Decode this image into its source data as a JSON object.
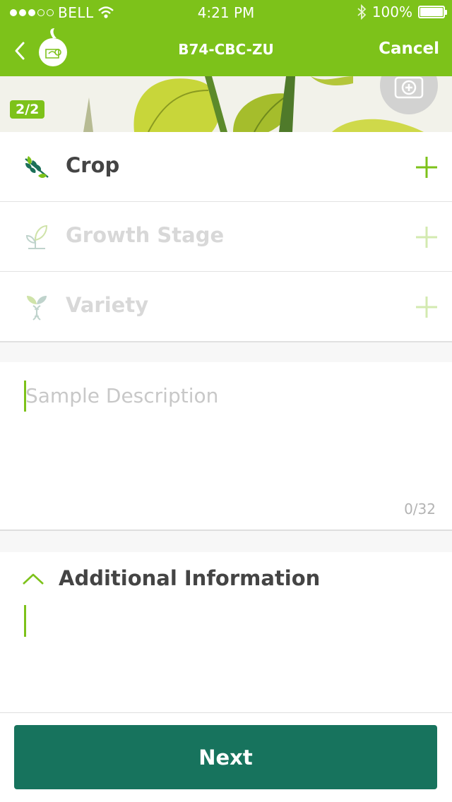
{
  "status_bar": {
    "carrier": "BELL",
    "time": "4:21 PM",
    "battery": "100%"
  },
  "nav": {
    "title": "B74-CBC-ZU",
    "cancel_label": "Cancel",
    "back_icon": "chevron-left-icon",
    "logo_icon": "app-logo-icon"
  },
  "banner": {
    "page_indicator": "2/2",
    "camera_icon": "add-photo-icon"
  },
  "fields": [
    {
      "label": "Crop",
      "icon": "wheat-icon",
      "enabled": true
    },
    {
      "label": "Growth Stage",
      "icon": "sprout-icon",
      "enabled": false
    },
    {
      "label": "Variety",
      "icon": "dna-plant-icon",
      "enabled": false
    }
  ],
  "description": {
    "placeholder": "Sample Description",
    "counter": "0/32"
  },
  "additional": {
    "title": "Additional Information"
  },
  "footer": {
    "next_label": "Next"
  },
  "colors": {
    "brand_green": "#7dc21a",
    "button_teal": "#17735d",
    "text_dark": "#444444",
    "text_disabled": "#d8d8d8"
  }
}
